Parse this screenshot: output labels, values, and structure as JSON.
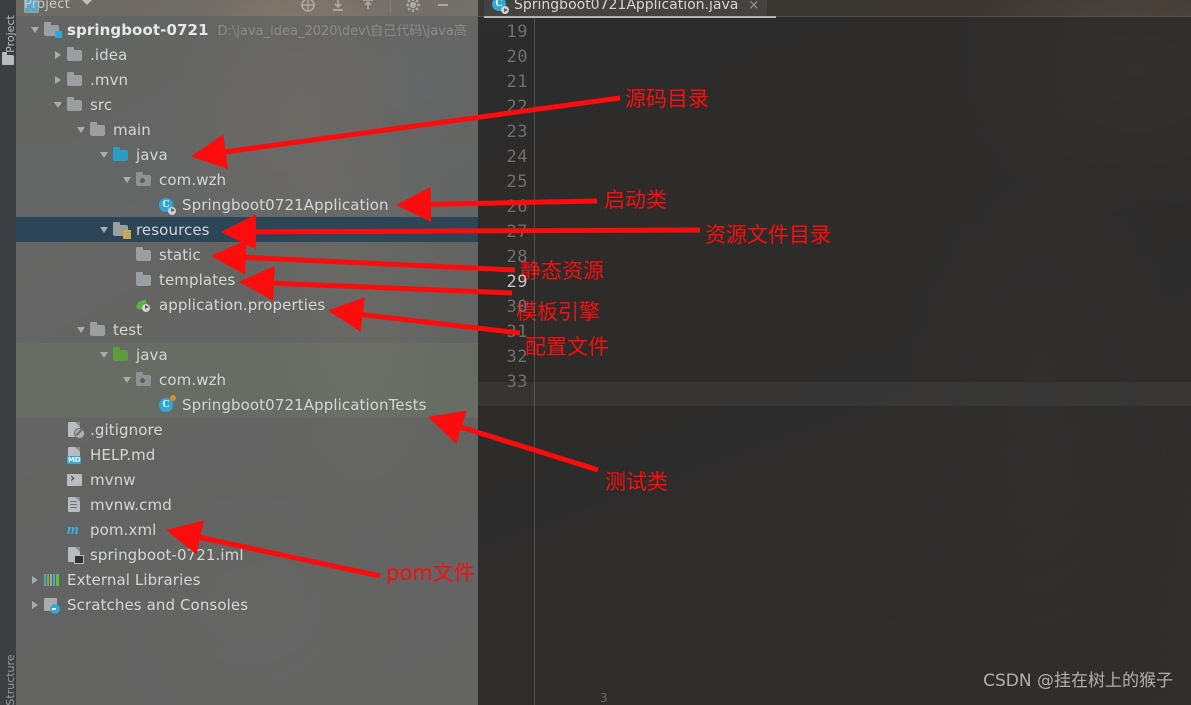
{
  "window": {
    "tool_window_title": "Project",
    "left_vertical_tabs": [
      "Project",
      "Structure"
    ],
    "toolbar_icons": [
      "locate-target-icon",
      "collapse-all-icon",
      "expand-all-icon",
      "settings-gear-icon",
      "hide-window-icon"
    ],
    "watermark": "CSDN @挂在树上的猴子"
  },
  "editor": {
    "tab_label": "Springboot0721Application.java",
    "tab_icon": "java-class-icon",
    "tab_close": "×",
    "gutter_lines": [
      "19",
      "20",
      "21",
      "22",
      "23",
      "24",
      "25",
      "26",
      "27",
      "28",
      "29",
      "30",
      "31",
      "32",
      "33"
    ],
    "current_line": "29",
    "bottom_marker": "3"
  },
  "tree": {
    "root": {
      "name": "springboot-0721",
      "path": "D:\\java_idea_2020\\dev\\自己代码\\java高"
    },
    "items": [
      {
        "label": "springboot-0721",
        "icon": "project-folder-icon",
        "indent": 0,
        "arrow": "down",
        "selected": false,
        "bold": true
      },
      {
        "label": ".idea",
        "icon": "folder-icon",
        "indent": 1,
        "arrow": "right",
        "selected": false
      },
      {
        "label": ".mvn",
        "icon": "folder-icon",
        "indent": 1,
        "arrow": "right",
        "selected": false
      },
      {
        "label": "src",
        "icon": "folder-icon",
        "indent": 1,
        "arrow": "down",
        "selected": false
      },
      {
        "label": "main",
        "icon": "folder-icon",
        "indent": 2,
        "arrow": "down",
        "selected": false
      },
      {
        "label": "java",
        "icon": "source-root-folder-icon",
        "indent": 3,
        "arrow": "down",
        "selected": false
      },
      {
        "label": "com.wzh",
        "icon": "package-icon",
        "indent": 4,
        "arrow": "down",
        "selected": false
      },
      {
        "label": "Springboot0721Application",
        "icon": "spring-boot-class-icon",
        "indent": 5,
        "arrow": "none",
        "selected": false
      },
      {
        "label": "resources",
        "icon": "resources-folder-icon",
        "indent": 3,
        "arrow": "down",
        "selected": true
      },
      {
        "label": "static",
        "icon": "folder-icon",
        "indent": 4,
        "arrow": "none",
        "selected": false
      },
      {
        "label": "templates",
        "icon": "folder-icon",
        "indent": 4,
        "arrow": "none",
        "selected": false
      },
      {
        "label": "application.properties",
        "icon": "spring-properties-icon",
        "indent": 4,
        "arrow": "none",
        "selected": false
      },
      {
        "label": "test",
        "icon": "folder-icon",
        "indent": 2,
        "arrow": "down",
        "selected": false
      },
      {
        "label": "java",
        "icon": "test-source-root-folder-icon",
        "indent": 3,
        "arrow": "down",
        "selected": false
      },
      {
        "label": "com.wzh",
        "icon": "package-icon",
        "indent": 4,
        "arrow": "down",
        "selected": false
      },
      {
        "label": "Springboot0721ApplicationTests",
        "icon": "test-class-icon",
        "indent": 5,
        "arrow": "none",
        "selected": false
      },
      {
        "label": ".gitignore",
        "icon": "gitignore-file-icon",
        "indent": 1,
        "arrow": "none",
        "selected": false
      },
      {
        "label": "HELP.md",
        "icon": "markdown-file-icon",
        "indent": 1,
        "arrow": "none",
        "selected": false
      },
      {
        "label": "mvnw",
        "icon": "shell-script-icon",
        "indent": 1,
        "arrow": "none",
        "selected": false
      },
      {
        "label": "mvnw.cmd",
        "icon": "text-file-icon",
        "indent": 1,
        "arrow": "none",
        "selected": false
      },
      {
        "label": "pom.xml",
        "icon": "maven-pom-icon",
        "indent": 1,
        "arrow": "none",
        "selected": false
      },
      {
        "label": "springboot-0721.iml",
        "icon": "iml-module-file-icon",
        "indent": 1,
        "arrow": "none",
        "selected": false
      },
      {
        "label": "External Libraries",
        "icon": "external-libraries-icon",
        "indent": 0,
        "arrow": "right",
        "selected": false
      },
      {
        "label": "Scratches and Consoles",
        "icon": "scratches-icon",
        "indent": 0,
        "arrow": "right",
        "selected": false
      }
    ]
  },
  "annotations": {
    "color": "#fb0d0d",
    "labels": [
      {
        "text": "源码目录",
        "target": "java"
      },
      {
        "text": "启动类",
        "target": "Springboot0721Application"
      },
      {
        "text": "资源文件目录",
        "target": "resources"
      },
      {
        "text": "静态资源",
        "target": "static"
      },
      {
        "text": "模板引擎",
        "target": "templates"
      },
      {
        "text": "配置文件",
        "target": "application.properties"
      },
      {
        "text": "测试类",
        "target": "Springboot0721ApplicationTests"
      },
      {
        "text": "pom文件",
        "target": "pom.xml"
      }
    ]
  }
}
